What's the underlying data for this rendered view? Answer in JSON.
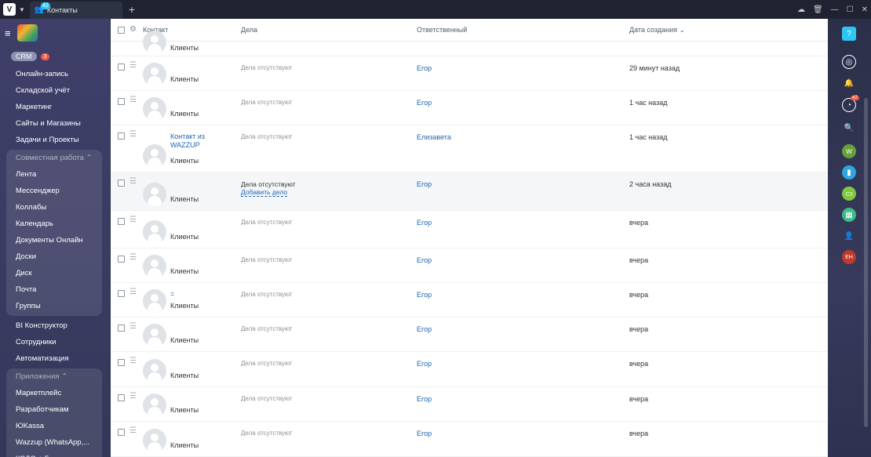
{
  "titlebar": {
    "app_logo": "V",
    "tab_label": "Контакты",
    "tab_badge": "42",
    "tab_add": "+",
    "controls": [
      "cloud-icon",
      "trash-icon",
      "minimize-icon",
      "maximize-icon",
      "close-icon"
    ]
  },
  "sidebar": {
    "crm_label": "CRM",
    "crm_count": "3",
    "items_top": [
      "Онлайн-запись",
      "Складской учёт",
      "Маркетинг",
      "Сайты и Магазины",
      "Задачи и Проекты"
    ],
    "group1_title": "Совместная работа ⌃",
    "group1_items": [
      "Лента",
      "Мессенджер",
      "Коллабы",
      "Календарь",
      "Документы Онлайн",
      "Доски",
      "Диск",
      "Почта",
      "Группы"
    ],
    "items_mid": [
      "BI Конструктор",
      "Сотрудники",
      "Автоматизация"
    ],
    "group2_title": "Приложения ⌃",
    "group2_items": [
      "Маркетплейс",
      "Разработчикам",
      "ЮKassa",
      "Wazzup (WhatsApp,...",
      "КЭДО + Госключ"
    ]
  },
  "table": {
    "headers": {
      "contact": "Контакт",
      "deals": "Дела",
      "responsible": "Ответственный",
      "created": "Дата создания ⌄"
    },
    "rows": [
      {
        "name": "",
        "type": "Клиенты",
        "deals": "",
        "responsible": "",
        "date": ""
      },
      {
        "name": "",
        "type": "Клиенты",
        "deals": "Дела отсутствуют",
        "responsible": "Егор",
        "date": "29 минут назад"
      },
      {
        "name": "",
        "type": "Клиенты",
        "deals": "Дела отсутствуют",
        "responsible": "Егор",
        "date": "1 час назад"
      },
      {
        "name": "Контакт из WAZZUP",
        "type": "Клиенты",
        "deals": "Дела отсутствуют",
        "responsible": "Елизавета",
        "date": "1 час назад"
      },
      {
        "name": "",
        "type": "Клиенты",
        "deals": "Дела отсутствуют",
        "add_deal": "Добавить дело",
        "responsible": "Егор",
        "date": "2 часа назад"
      },
      {
        "name": "",
        "type": "Клиенты",
        "deals": "Дела отсутствуют",
        "responsible": "Егор",
        "date": "вчера"
      },
      {
        "name": "",
        "type": "Клиенты",
        "deals": "Дела отсутствуют",
        "responsible": "Егор",
        "date": "вчера"
      },
      {
        "name": "=",
        "type": "Клиенты",
        "deals": "Дела отсутствуют",
        "responsible": "Егор",
        "date": "вчера"
      },
      {
        "name": "",
        "type": "Клиенты",
        "deals": "Дела отсутствуют",
        "responsible": "Егор",
        "date": "вчера"
      },
      {
        "name": "",
        "type": "Клиенты",
        "deals": "Дела отсутствуют",
        "responsible": "Егор",
        "date": "вчера"
      },
      {
        "name": "",
        "type": "Клиенты",
        "deals": "Дела отсутствуют",
        "responsible": "Егор",
        "date": "вчера"
      },
      {
        "name": "",
        "type": "Клиенты",
        "deals": "Дела отсутствуют",
        "responsible": "Егор",
        "date": "вчера"
      }
    ]
  },
  "right_panel": {
    "help": "?",
    "notif_count": "47",
    "avatar_w": "W",
    "avatar_eh": "ЕН"
  }
}
